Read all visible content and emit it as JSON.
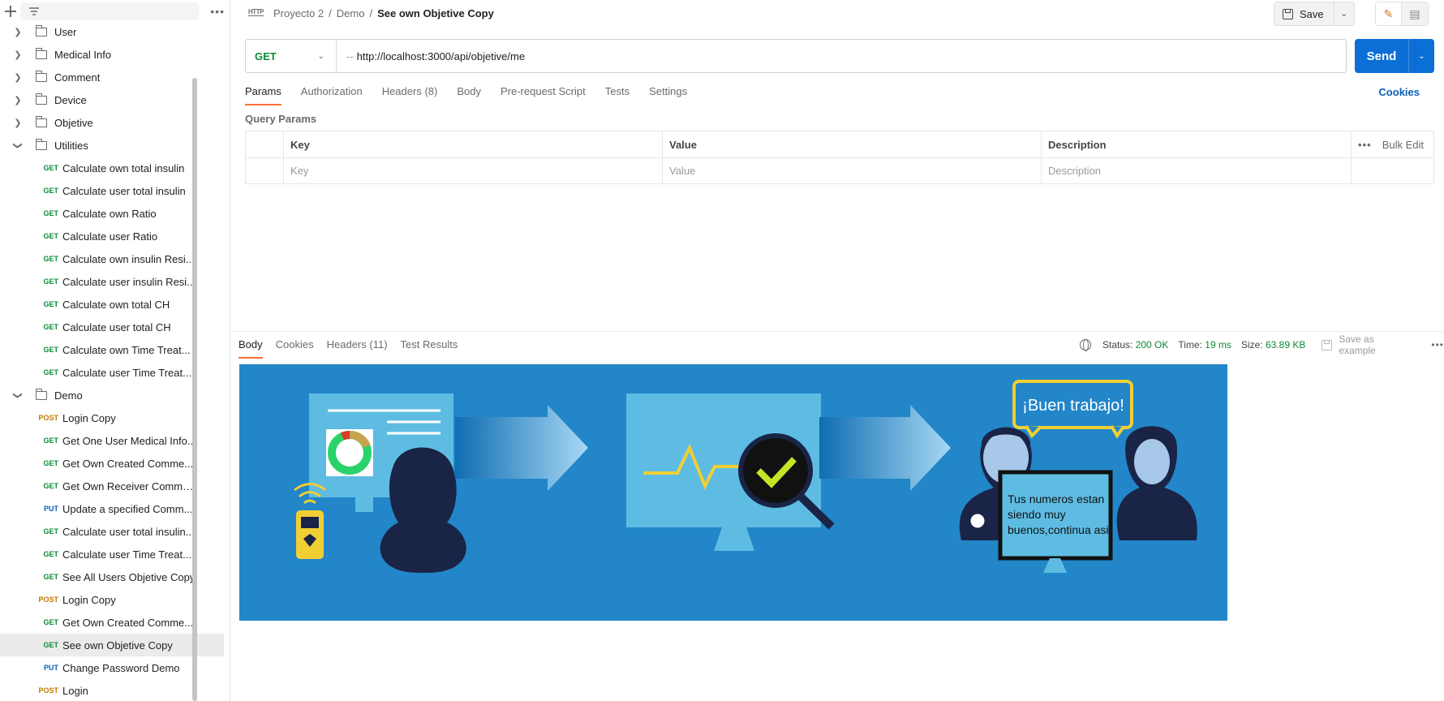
{
  "sidebar": {
    "folders_top": [
      {
        "label": "User",
        "expanded": false
      },
      {
        "label": "Medical Info",
        "expanded": false
      },
      {
        "label": "Comment",
        "expanded": false
      },
      {
        "label": "Device",
        "expanded": false
      },
      {
        "label": "Objetive",
        "expanded": false
      },
      {
        "label": "Utilities",
        "expanded": true
      }
    ],
    "utilities_items": [
      {
        "method": "GET",
        "label": "Calculate own total insulin"
      },
      {
        "method": "GET",
        "label": "Calculate user total insulin"
      },
      {
        "method": "GET",
        "label": "Calculate own Ratio"
      },
      {
        "method": "GET",
        "label": "Calculate user Ratio"
      },
      {
        "method": "GET",
        "label": "Calculate own insulin Resi..."
      },
      {
        "method": "GET",
        "label": "Calculate user insulin Resi..."
      },
      {
        "method": "GET",
        "label": "Calculate own total CH"
      },
      {
        "method": "GET",
        "label": "Calculate user total CH"
      },
      {
        "method": "GET",
        "label": "Calculate own Time Treat..."
      },
      {
        "method": "GET",
        "label": "Calculate user Time Treat..."
      }
    ],
    "demo_folder": {
      "label": "Demo",
      "expanded": true
    },
    "demo_items": [
      {
        "method": "POST",
        "label": "Login Copy"
      },
      {
        "method": "GET",
        "label": "Get One User Medical Info..."
      },
      {
        "method": "GET",
        "label": "Get Own Created Comme..."
      },
      {
        "method": "GET",
        "label": "Get Own Receiver Comme..."
      },
      {
        "method": "PUT",
        "label": "Update a specified Comm..."
      },
      {
        "method": "GET",
        "label": "Calculate user total insulin..."
      },
      {
        "method": "GET",
        "label": "Calculate user Time Treat..."
      },
      {
        "method": "GET",
        "label": "See All Users Objetive Copy"
      },
      {
        "method": "POST",
        "label": "Login Copy"
      },
      {
        "method": "GET",
        "label": "Get Own Created Comme..."
      },
      {
        "method": "GET",
        "label": "See own Objetive Copy",
        "active": true
      },
      {
        "method": "PUT",
        "label": "Change Password Demo"
      },
      {
        "method": "POST",
        "label": "Login"
      }
    ]
  },
  "header": {
    "http_badge": "HTTP",
    "breadcrumb": {
      "part1": "Proyecto 2",
      "part2": "Demo",
      "current": "See own Objetive Copy",
      "sep": "/"
    },
    "save_label": "Save"
  },
  "request": {
    "method": "GET",
    "url": "http://localhost:3000/api/objetive/me",
    "send_label": "Send",
    "tabs": {
      "params": "Params",
      "authorization": "Authorization",
      "headers": "Headers",
      "headers_count": "(8)",
      "body": "Body",
      "prerequest": "Pre-request Script",
      "tests": "Tests",
      "settings": "Settings"
    },
    "cookies_link": "Cookies",
    "query_params": {
      "title": "Query Params",
      "columns": {
        "key": "Key",
        "value": "Value",
        "description": "Description"
      },
      "bulk_edit": "Bulk Edit",
      "placeholders": {
        "key": "Key",
        "value": "Value",
        "description": "Description"
      }
    }
  },
  "response": {
    "tabs": {
      "body": "Body",
      "cookies": "Cookies",
      "headers": "Headers",
      "headers_count": "(11)",
      "test_results": "Test Results"
    },
    "status_label": "Status:",
    "status_value": "200 OK",
    "time_label": "Time:",
    "time_value": "19 ms",
    "size_label": "Size:",
    "size_value": "63.89 KB",
    "save_example": "Save as example",
    "image": {
      "bubble_text": "¡Buen trabajo!",
      "screen_line1": "Tus numeros estan",
      "screen_line2": "siendo muy",
      "screen_line3": "buenos,continua asi."
    }
  },
  "colors": {
    "accent": "#ff6c37",
    "send": "#0b6fd6",
    "get": "#0c8a37",
    "post": "#c17a00",
    "put": "#0a5fb4",
    "preview_bg": "#2286c8"
  }
}
